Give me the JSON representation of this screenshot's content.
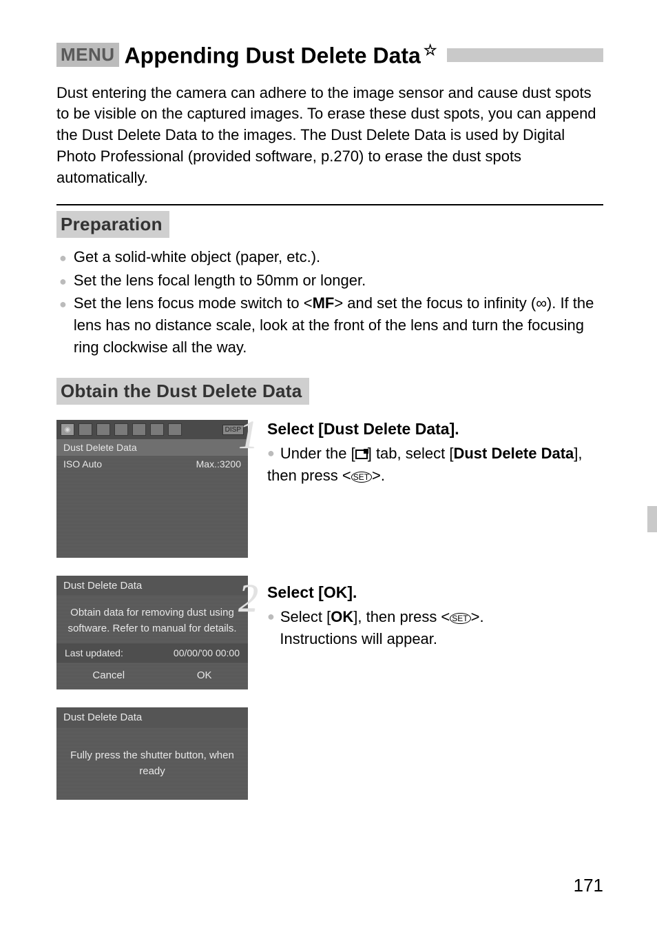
{
  "header": {
    "menu_label": "MENU",
    "title": "Appending Dust Delete Data",
    "star": "☆"
  },
  "intro": "Dust entering the camera can adhere to the image sensor and cause dust spots to be visible on the captured images. To erase these dust spots, you can append the Dust Delete Data to the images. The Dust Delete Data is used by Digital Photo Professional (provided software, p.270) to erase the dust spots automatically.",
  "prep": {
    "heading": "Preparation",
    "items": [
      "Get a solid-white object (paper, etc.).",
      "Set the lens focal length to 50mm or longer.",
      "Set the lens focus mode switch to <MF> and set the focus to infinity (∞). If the lens has no distance scale, look at the front of the lens and turn the focusing ring clockwise all the way."
    ]
  },
  "obtain_heading": "Obtain the Dust Delete Data",
  "screens": {
    "s1": {
      "disp": "DISP",
      "row1": "Dust Delete Data",
      "row2a": "ISO Auto",
      "row2b": "Max.:3200"
    },
    "s2": {
      "hdr": "Dust Delete Data",
      "msg": "Obtain data for removing dust using software. Refer to manual for details.",
      "meta_label": "Last updated:",
      "meta_value": "00/00/'00 00:00",
      "cancel": "Cancel",
      "ok": "OK"
    },
    "s3": {
      "hdr": "Dust Delete Data",
      "msg": "Fully press the shutter button, when ready"
    }
  },
  "steps": [
    {
      "num": "1",
      "title": "Select [Dust Delete Data].",
      "body_prefix": "Under the [",
      "body_mid": "] tab, select [",
      "body_bold": "Dust Delete Data",
      "body_suffix1": "], then press <",
      "body_suffix2": ">.",
      "set_label": "SET"
    },
    {
      "num": "2",
      "title": "Select [OK].",
      "line1_prefix": "Select [",
      "line1_bold": "OK",
      "line1_mid": "], then press <",
      "line1_suffix": ">.",
      "set_label": "SET",
      "line2": "Instructions will appear."
    }
  ],
  "page_number": "171"
}
